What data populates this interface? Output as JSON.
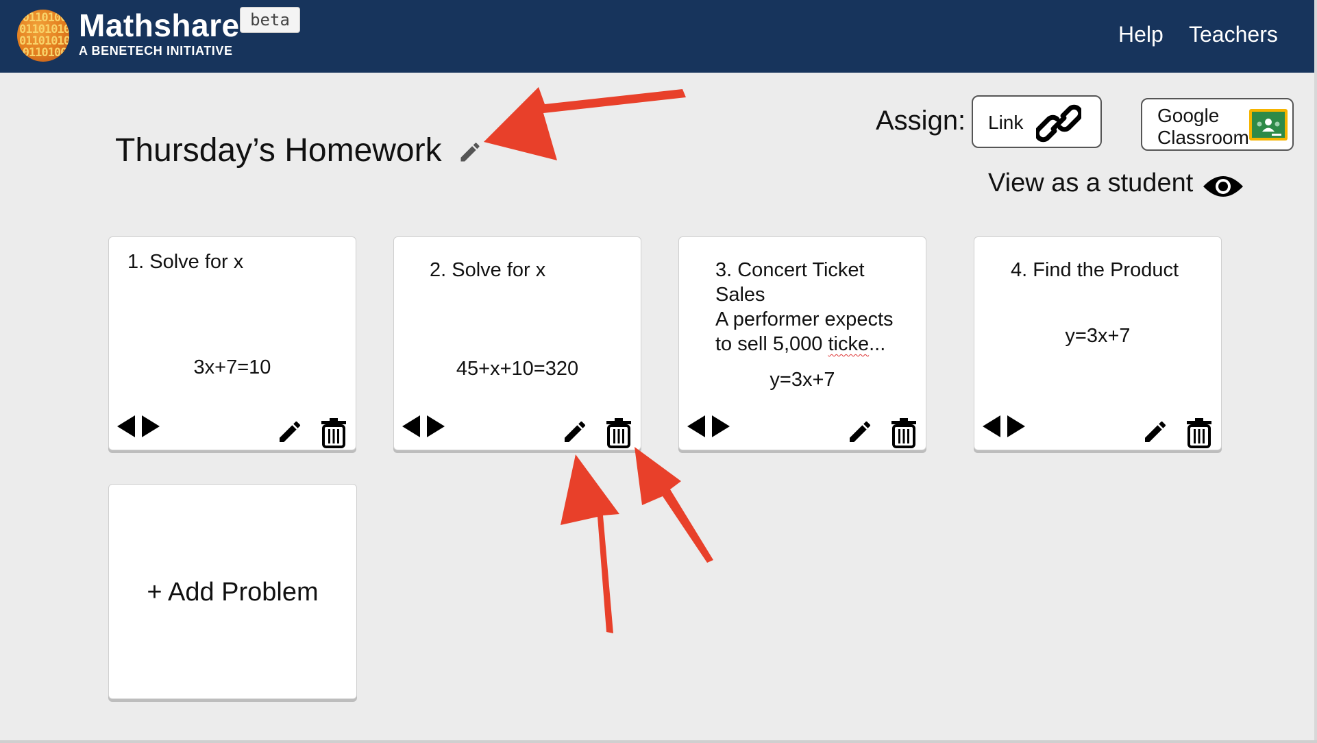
{
  "header": {
    "brand_name": "Mathshare",
    "brand_subtitle": "A BENETECH INITIATIVE",
    "beta_label": "beta",
    "nav": [
      "Help",
      "Teachers"
    ]
  },
  "page": {
    "title": "Thursday’s Homework",
    "assign_label": "Assign:",
    "link_button": "Link",
    "google_button_line1": "Google",
    "google_button_line2": "Classroom",
    "view_as_student": "View as a student"
  },
  "problems": [
    {
      "title": "1.   Solve for x",
      "equation": "3x+7=10"
    },
    {
      "title": "2. Solve for x",
      "equation": "45+x+10=320"
    },
    {
      "title_lines": [
        "3. Concert Ticket",
        "Sales",
        "A performer expects"
      ],
      "last_line_start": "to sell 5,000 ",
      "last_line_word": "ticke",
      "last_line_end": "...",
      "equation": "y=3x+7"
    },
    {
      "title": "4. Find the Product",
      "equation": "y=3x+7"
    }
  ],
  "add_problem_label": "+ Add Problem",
  "icons": {
    "logo": "mathshare-logo-icon",
    "title_edit": "pencil-icon",
    "link": "chain-link-icon",
    "google_classroom": "google-classroom-icon",
    "eye": "eye-icon",
    "reorder": "left-right-arrows-icon",
    "edit": "pencil-icon",
    "delete": "trash-icon"
  },
  "colors": {
    "header_bg": "#17345c",
    "page_bg": "#ececec",
    "annotation_arrow": "#e8402a",
    "classroom_green": "#2e8a48"
  }
}
